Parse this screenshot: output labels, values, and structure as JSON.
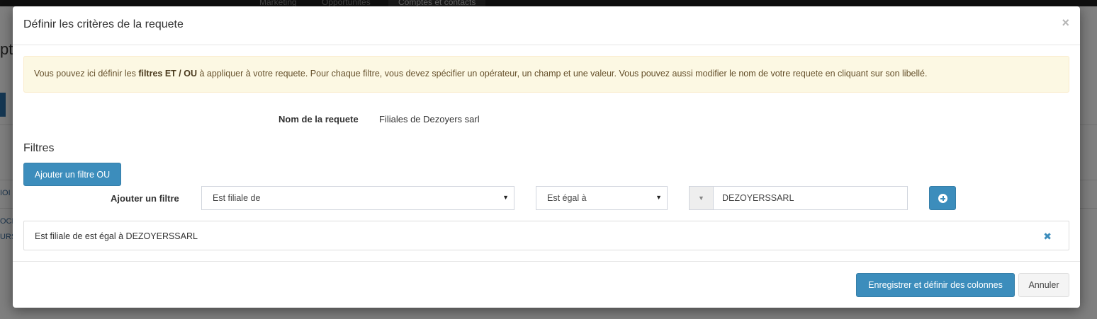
{
  "background": {
    "nav": [
      "Marketing",
      "Opportunités",
      "Comptes et contacts"
    ],
    "page_title_fragment": "pt",
    "side_fragments": [
      "IOI",
      "OCI",
      "URS"
    ]
  },
  "modal": {
    "title": "Définir les critères de la requete",
    "close_symbol": "×",
    "alert": {
      "text_before": "Vous pouvez ici définir les ",
      "text_bold": "filtres ET / OU",
      "text_after": " à appliquer à votre requete. Pour chaque filtre, vous devez spécifier un opérateur, un champ et une valeur. Vous pouvez aussi modifier le nom de votre requete en cliquant sur son libellé."
    },
    "query_name": {
      "label": "Nom de la requete",
      "value": "Filiales de Dezoyers sarl"
    },
    "filters": {
      "heading": "Filtres",
      "add_or_button": "Ajouter un filtre OU",
      "add_filter_label": "Ajouter un filtre",
      "field_select": "Est filiale de",
      "operator_select": "Est égal à",
      "value_input": "DEZOYERSSARL",
      "active_filters": [
        {
          "text": "Est filiale de est égal à DEZOYERSSARL"
        }
      ]
    },
    "footer": {
      "save_button": "Enregistrer et définir des colonnes",
      "cancel_button": "Annuler"
    }
  },
  "colors": {
    "primary": "#3c8dbc",
    "alert_bg": "#fcf8e3",
    "alert_text": "#66512c"
  }
}
